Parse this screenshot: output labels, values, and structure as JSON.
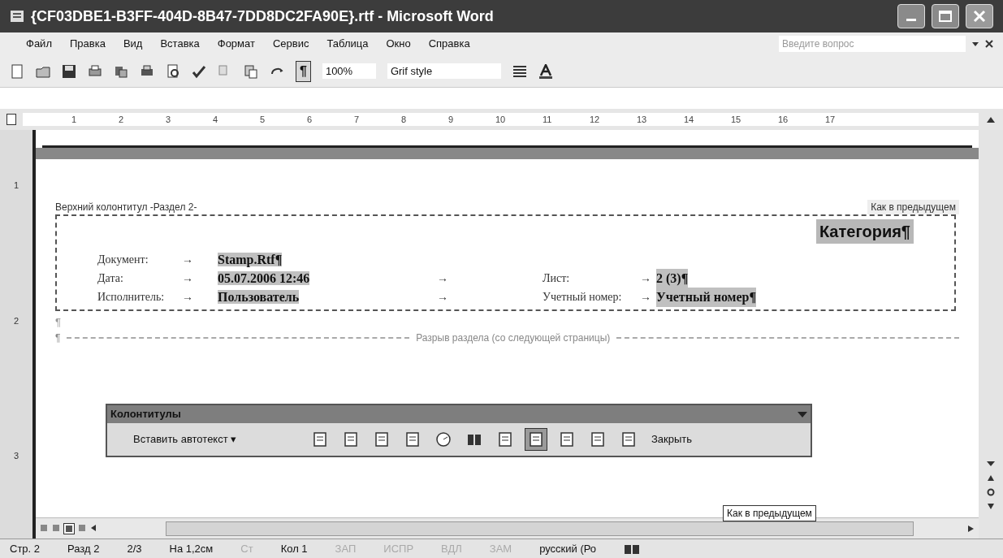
{
  "window": {
    "title": "{CF03DBE1-B3FF-404D-8B47-7DD8DC2FA90E}.rtf - Microsoft Word"
  },
  "menu": [
    "Файл",
    "Правка",
    "Вид",
    "Вставка",
    "Формат",
    "Сервис",
    "Таблица",
    "Окно",
    "Справка"
  ],
  "help_field": {
    "placeholder": "Введите вопрос"
  },
  "toolbar": {
    "marks_button": "¶",
    "zoom": "100%",
    "style": "Grif style",
    "show_marks": true
  },
  "ruler": [
    "1",
    "2",
    "3",
    "4",
    "5",
    "6",
    "7",
    "8",
    "9",
    "10",
    "11",
    "12",
    "13",
    "14",
    "15",
    "16",
    "17"
  ],
  "vertical_ruler": [
    "1",
    "2",
    "3"
  ],
  "header": {
    "label": "Верхний колонтитул -Раздел 2-",
    "link_label": "Как в предыдущем",
    "category": "Категория¶",
    "rows": [
      {
        "label": "Документ:",
        "tab": "→",
        "value": "Stamp.Rtf¶"
      },
      {
        "label": "Дата:",
        "tab": "→",
        "value": "05.07.2006 12:46",
        "tab_mid": "→",
        "label2": "Лист:",
        "tab2": "→",
        "value2": "2 (3)¶"
      },
      {
        "label": "Исполнитель:",
        "tab": "→",
        "value": "Пользователь",
        "tab_mid": "→",
        "label2": "Учетный номер:",
        "tab2": "→",
        "value2": "Учетный номер¶"
      }
    ]
  },
  "empty_paragraphs": [
    "¶",
    "¶"
  ],
  "section_break": "Разрыв раздела (со следующей страницы)",
  "float_toolbar": {
    "title": "Колонтитулы",
    "autotext": "Вставить автотекст ▾",
    "close": "Закрыть",
    "buttons": [
      {
        "kind": "page",
        "pressed": false
      },
      {
        "kind": "page",
        "pressed": false
      },
      {
        "kind": "page",
        "pressed": false
      },
      {
        "kind": "page",
        "pressed": false
      },
      {
        "kind": "clock",
        "pressed": false
      },
      {
        "kind": "book",
        "pressed": false
      },
      {
        "kind": "page",
        "pressed": false
      },
      {
        "kind": "page",
        "pressed": true
      },
      {
        "kind": "page",
        "pressed": false
      },
      {
        "kind": "page",
        "pressed": false
      },
      {
        "kind": "page",
        "pressed": false
      }
    ]
  },
  "tooltip": "Как в предыдущем",
  "status_bar": [
    {
      "text": "Стр. 2",
      "disabled": false
    },
    {
      "text": "Разд 2",
      "disabled": false
    },
    {
      "text": "2/3",
      "disabled": false
    },
    {
      "text": "На 1,2см",
      "disabled": false
    },
    {
      "text": "Ст",
      "disabled": true
    },
    {
      "text": "Кол 1",
      "disabled": false
    },
    {
      "text": "ЗАП",
      "disabled": true
    },
    {
      "text": "ИСПР",
      "disabled": true
    },
    {
      "text": "ВДЛ",
      "disabled": true
    },
    {
      "text": "ЗАМ",
      "disabled": true
    },
    {
      "text": "русский (Ро",
      "disabled": false
    }
  ]
}
